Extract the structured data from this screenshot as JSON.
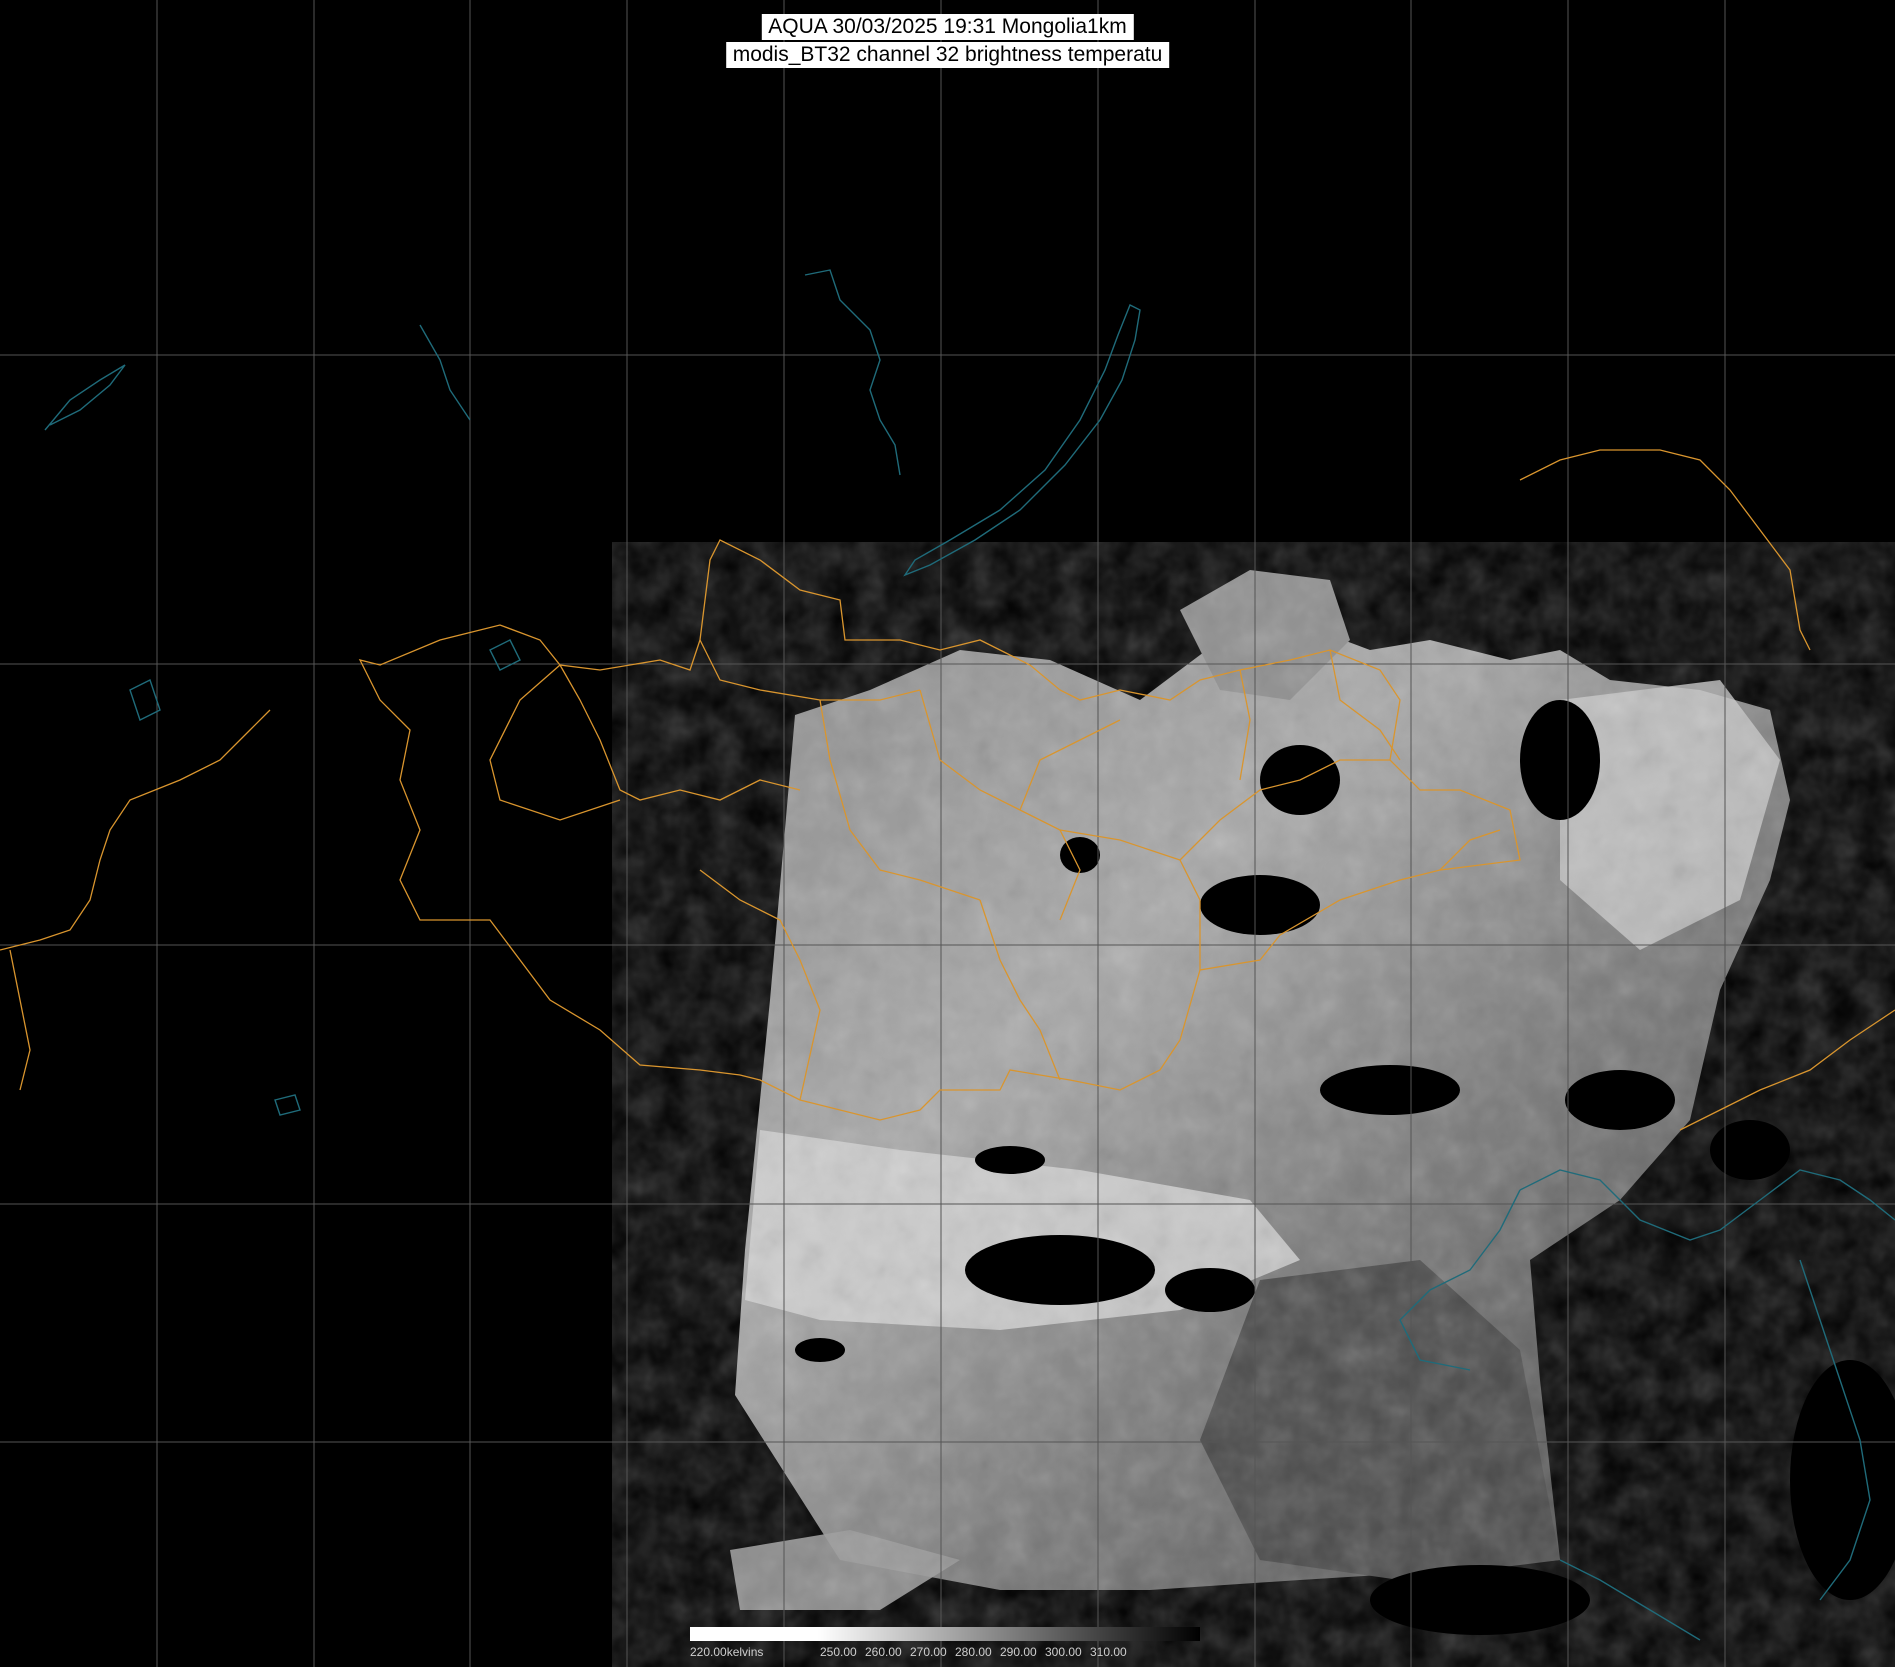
{
  "title": {
    "line1": "AQUA 30/03/2025 19:31 Mongolia1km",
    "line2": "modis_BT32 channel 32 brightness temperatu"
  },
  "colorbar": {
    "labels": [
      "220.00kelvins",
      "250.00",
      "260.00",
      "270.00",
      "280.00",
      "290.00",
      "300.00",
      "310.00"
    ],
    "min_kelvin": 220,
    "max_kelvin": 310,
    "palette": "white-to-black"
  },
  "colors": {
    "background": "#000000",
    "grid": "#555555",
    "borders": "#d9952e",
    "coast": "#1f6b7a",
    "imagery_light": "#d8d8d8",
    "imagery_dark": "#3a3a3a"
  }
}
